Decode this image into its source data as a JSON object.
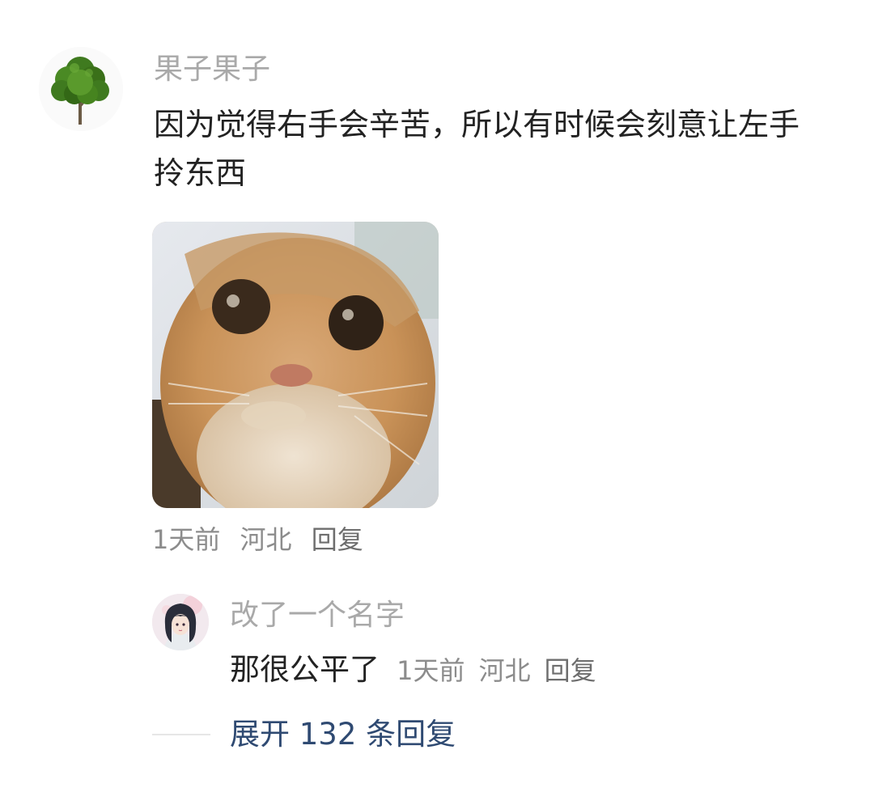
{
  "comment": {
    "username": "果子果子",
    "text_line1": "因为觉得右手会辛苦，所以有时候会刻意让左手",
    "text_line2": "拎东西",
    "time": "1天前",
    "location": "河北",
    "reply_label": "回复"
  },
  "reply": {
    "username": "改了一个名字",
    "text": "那很公平了",
    "time": "1天前",
    "location": "河北",
    "reply_label": "回复"
  },
  "expand": {
    "label": "展开 132 条回复"
  },
  "colors": {
    "username": "#a9a9a9",
    "body_text": "#222222",
    "meta": "#8c8c8c",
    "expand_link": "#2f4a72"
  }
}
